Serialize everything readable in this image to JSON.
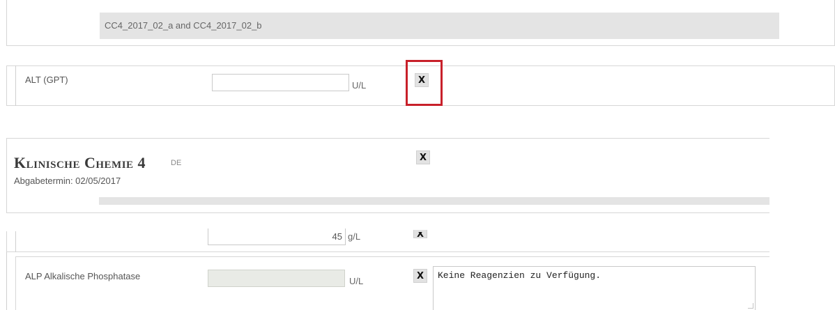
{
  "top_panel": {
    "sample_ids": "CC4_2017_02_a and CC4_2017_02_b"
  },
  "alt_row": {
    "label": "ALT (GPT)",
    "value": "",
    "unit": "U/L",
    "remove_label": "X"
  },
  "header": {
    "title": "Klinische Chemie 4",
    "language": "DE",
    "deadline": "Abgabetermin: 02/05/2017",
    "remove_label": "X"
  },
  "partial_row": {
    "value": "45",
    "unit": "g/L",
    "remove_label": "X"
  },
  "alp_row": {
    "label": "ALP Alkalische Phosphatase",
    "value": "",
    "unit": "U/L",
    "remove_label": "X",
    "comment": "Keine Reagenzien zu Verfügung."
  },
  "colors": {
    "highlight": "#c8202a",
    "disabled_input": "#e9ebe6"
  }
}
